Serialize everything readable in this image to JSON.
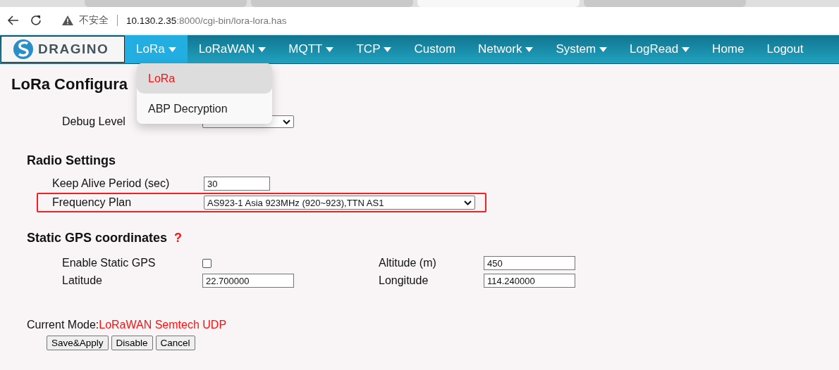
{
  "browser": {
    "tabs": [
      {
        "selected": false
      },
      {
        "selected": false
      },
      {
        "selected": true
      },
      {
        "selected": false
      }
    ],
    "security_label": "不安全",
    "url_host": "10.130.2.35",
    "url_path": ":8000/cgi-bin/lora-lora.has"
  },
  "nav": {
    "logo": "DRAGINO",
    "items": [
      {
        "label": "LoRa",
        "caret": true,
        "selected": true
      },
      {
        "label": "LoRaWAN",
        "caret": true,
        "selected": false
      },
      {
        "label": "MQTT",
        "caret": true,
        "selected": false
      },
      {
        "label": "TCP",
        "caret": true,
        "selected": false
      },
      {
        "label": "Custom",
        "caret": false,
        "selected": false
      },
      {
        "label": "Network",
        "caret": true,
        "selected": false
      },
      {
        "label": "System",
        "caret": true,
        "selected": false
      },
      {
        "label": "LogRead",
        "caret": true,
        "selected": false
      },
      {
        "label": "Home",
        "caret": false,
        "selected": false
      },
      {
        "label": "Logout",
        "caret": false,
        "selected": false
      }
    ],
    "dropdown": [
      {
        "label": "LoRa",
        "selected": true
      },
      {
        "label": "ABP Decryption",
        "selected": false
      }
    ]
  },
  "page": {
    "title": "LoRa Configura",
    "debug_level": {
      "label": "Debug Level"
    },
    "radio": {
      "heading": "Radio Settings",
      "keep_alive": {
        "label": "Keep Alive Period (sec)",
        "value": "30"
      },
      "frequency_plan": {
        "label": "Frequency Plan",
        "value": "AS923-1 Asia 923MHz (920~923),TTN AS1",
        "highlighted": true
      }
    },
    "gps": {
      "heading": "Static GPS coordinates",
      "help": "?",
      "enable": {
        "label": "Enable Static GPS",
        "checked": false
      },
      "altitude": {
        "label": "Altitude (m)",
        "value": "450"
      },
      "latitude": {
        "label": "Latitude",
        "value": "22.700000"
      },
      "longitude": {
        "label": "Longitude",
        "value": "114.240000"
      }
    },
    "mode": {
      "label": "Current Mode:",
      "value": "LoRaWAN Semtech UDP"
    },
    "buttons": [
      "Save&Apply",
      "Disable",
      "Cancel"
    ]
  }
}
